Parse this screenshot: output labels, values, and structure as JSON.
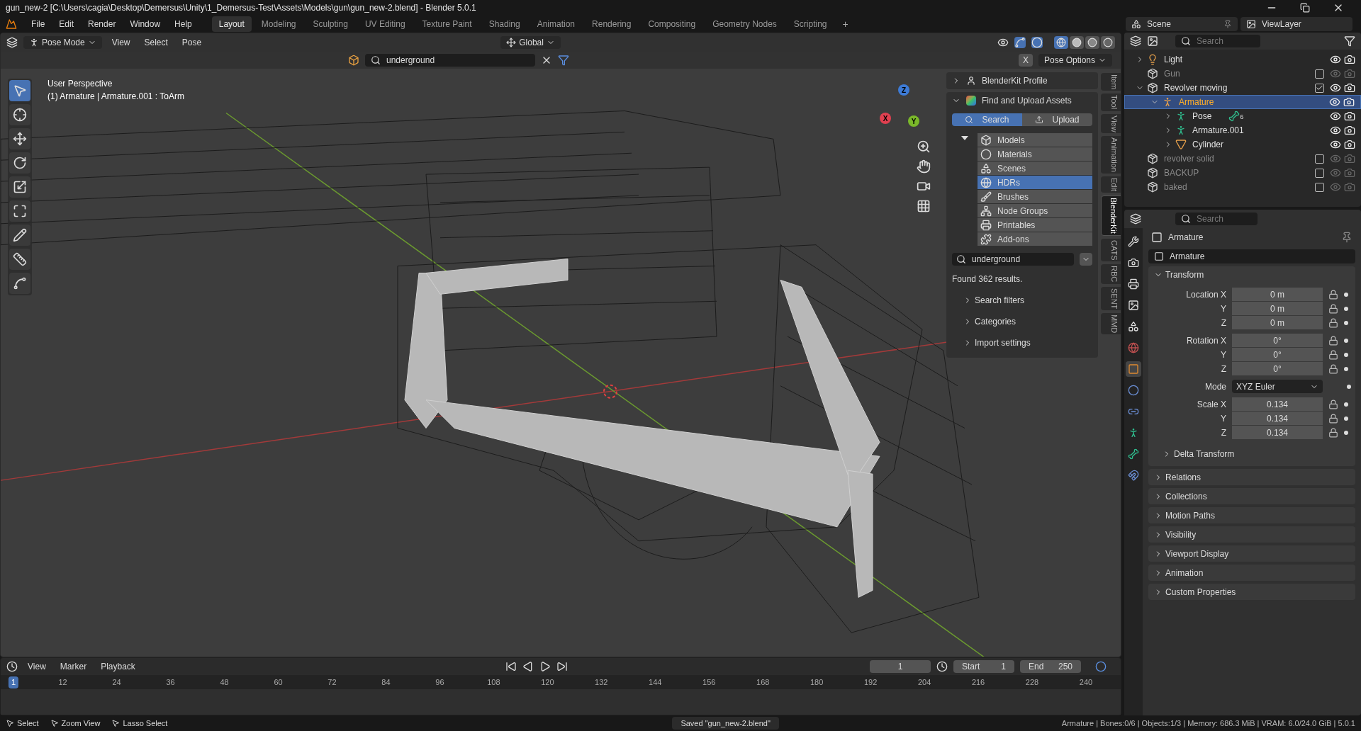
{
  "window": {
    "title": "gun_new-2 [C:\\Users\\cagia\\Desktop\\Demersus\\Unity\\1_Demersus-Test\\Assets\\Models\\gun\\gun_new-2.blend] - Blender 5.0.1"
  },
  "menu": [
    "File",
    "Edit",
    "Render",
    "Window",
    "Help"
  ],
  "workspaces": [
    {
      "label": "Layout",
      "selected": true
    },
    {
      "label": "Modeling",
      "selected": false
    },
    {
      "label": "Sculpting",
      "selected": false
    },
    {
      "label": "UV Editing",
      "selected": false
    },
    {
      "label": "Texture Paint",
      "selected": false
    },
    {
      "label": "Shading",
      "selected": false
    },
    {
      "label": "Animation",
      "selected": false
    },
    {
      "label": "Rendering",
      "selected": false
    },
    {
      "label": "Compositing",
      "selected": false
    },
    {
      "label": "Geometry Nodes",
      "selected": false
    },
    {
      "label": "Scripting",
      "selected": false
    }
  ],
  "add_workspace": "+",
  "viewport": {
    "mode": "Pose Mode",
    "menus": [
      "View",
      "Select",
      "Pose"
    ],
    "orientation": "Global",
    "shading": [
      {
        "kind": "wireframe",
        "selected": true
      },
      {
        "kind": "solid",
        "selected": false
      },
      {
        "kind": "material",
        "selected": false
      },
      {
        "kind": "rendered",
        "selected": false
      }
    ],
    "asset_search": "underground",
    "pose_options": "Pose Options",
    "mirror_x": "X",
    "overlay_lines": [
      "User Perspective",
      "(1) Armature | Armature.001 : ToArm"
    ],
    "gizmo_axes": [
      "X",
      "Y",
      "Z"
    ],
    "tools": [
      {
        "kind": "select",
        "selected": true
      },
      {
        "kind": "cursor",
        "selected": false
      },
      {
        "kind": "move",
        "selected": false
      },
      {
        "kind": "rotate",
        "selected": false
      },
      {
        "kind": "scale",
        "selected": false
      },
      {
        "kind": "transform",
        "selected": false
      },
      {
        "kind": "annotate",
        "selected": false
      },
      {
        "kind": "measure",
        "selected": false
      },
      {
        "kind": "relax",
        "selected": false
      }
    ],
    "side_tabs": [
      {
        "label": "Item",
        "selected": false
      },
      {
        "label": "Tool",
        "selected": false
      },
      {
        "label": "View",
        "selected": false
      },
      {
        "label": "Animation",
        "selected": false
      },
      {
        "label": "Edit",
        "selected": false
      },
      {
        "label": "BlenderKit",
        "selected": true
      },
      {
        "label": "CATS",
        "selected": false
      },
      {
        "label": "RBC",
        "selected": false
      },
      {
        "label": "SENT",
        "selected": false
      },
      {
        "label": "MMD",
        "selected": false
      }
    ]
  },
  "blenderkit": {
    "profile": "BlenderKit Profile",
    "find": "Find and Upload Assets",
    "modes": [
      {
        "label": "Search",
        "selected": true
      },
      {
        "label": "Upload",
        "selected": false
      }
    ],
    "categories_expanded": true,
    "categories": [
      {
        "label": "Models",
        "kind": "models",
        "selected": false
      },
      {
        "label": "Materials",
        "kind": "materials",
        "selected": false
      },
      {
        "label": "Scenes",
        "kind": "scenes",
        "selected": false
      },
      {
        "label": "HDRs",
        "kind": "hdrs",
        "selected": true
      },
      {
        "label": "Brushes",
        "kind": "brushes",
        "selected": false
      },
      {
        "label": "Node Groups",
        "kind": "nodes",
        "selected": false
      },
      {
        "label": "Printables",
        "kind": "printables",
        "selected": false
      },
      {
        "label": "Add-ons",
        "kind": "addons",
        "selected": false
      }
    ],
    "search_value": "underground",
    "results": "Found 362 results.",
    "sections": [
      "Search filters",
      "Categories",
      "Import settings"
    ]
  },
  "outliner": {
    "scene": "Scene",
    "view_layer": "ViewLayer",
    "search_placeholder": "Search",
    "tree": [
      {
        "label": "Light",
        "kind": "light",
        "selected": false,
        "expanded": false
      },
      {
        "label": "Gun",
        "kind": "collection",
        "selected": false,
        "checked": false
      },
      {
        "label": "Revolver moving",
        "kind": "collection",
        "selected": false,
        "checked": true,
        "expanded": true,
        "children": [
          {
            "label": "Armature",
            "kind": "armature",
            "selected": true,
            "expanded": true,
            "children": [
              {
                "label": "Pose",
                "kind": "pose",
                "selected": false,
                "badge": "6",
                "expanded": false
              },
              {
                "label": "Armature.001",
                "kind": "armature_data",
                "selected": false,
                "expanded": false
              },
              {
                "label": "Cylinder",
                "kind": "mesh",
                "selected": false,
                "expanded": false
              }
            ]
          }
        ]
      },
      {
        "label": "revolver solid",
        "kind": "collection",
        "selected": false,
        "checked": false
      },
      {
        "label": "BACKUP",
        "kind": "collection",
        "selected": false,
        "checked": false
      },
      {
        "label": "baked",
        "kind": "collection",
        "selected": false,
        "checked": false
      }
    ]
  },
  "properties": {
    "search_placeholder": "Search",
    "object": "Armature",
    "name": "Armature",
    "tabs": [
      {
        "kind": "tool",
        "selected": false
      },
      {
        "kind": "render",
        "selected": false
      },
      {
        "kind": "output",
        "selected": false
      },
      {
        "kind": "view_layer",
        "selected": false
      },
      {
        "kind": "scene",
        "selected": false
      },
      {
        "kind": "world",
        "selected": false
      },
      {
        "kind": "object",
        "selected": true
      },
      {
        "kind": "physics",
        "selected": false
      },
      {
        "kind": "constraints",
        "selected": false
      },
      {
        "kind": "data",
        "selected": false
      },
      {
        "kind": "bone",
        "selected": false
      },
      {
        "kind": "bone_constraints",
        "selected": false
      }
    ],
    "transform": {
      "title": "Transform",
      "expanded": true,
      "groups": [
        [
          {
            "label": "Location X",
            "value": "0 m"
          },
          {
            "label": "Y",
            "value": "0 m"
          },
          {
            "label": "Z",
            "value": "0 m"
          }
        ],
        [
          {
            "label": "Rotation X",
            "value": "0°"
          },
          {
            "label": "Y",
            "value": "0°"
          },
          {
            "label": "Z",
            "value": "0°"
          }
        ],
        [
          {
            "label": "Mode",
            "value": "XYZ Euler",
            "kind": "dropdown"
          }
        ],
        [
          {
            "label": "Scale X",
            "value": "0.134"
          },
          {
            "label": "Y",
            "value": "0.134"
          },
          {
            "label": "Z",
            "value": "0.134"
          }
        ]
      ],
      "delta": "Delta Transform"
    },
    "panels": [
      "Relations",
      "Collections",
      "Motion Paths",
      "Visibility",
      "Viewport Display",
      "Animation",
      "Custom Properties"
    ]
  },
  "timeline": {
    "menus": [
      "View",
      "Marker",
      "Playback"
    ],
    "current_frame": "1",
    "start_label": "Start",
    "start": "1",
    "end_label": "End",
    "end": "250",
    "ticks": [
      {
        "label": "1",
        "selected": true
      },
      {
        "label": "12",
        "selected": false
      },
      {
        "label": "24",
        "selected": false
      },
      {
        "label": "36",
        "selected": false
      },
      {
        "label": "48",
        "selected": false
      },
      {
        "label": "60",
        "selected": false
      },
      {
        "label": "72",
        "selected": false
      },
      {
        "label": "84",
        "selected": false
      },
      {
        "label": "96",
        "selected": false
      },
      {
        "label": "108",
        "selected": false
      },
      {
        "label": "120",
        "selected": false
      },
      {
        "label": "132",
        "selected": false
      },
      {
        "label": "144",
        "selected": false
      },
      {
        "label": "156",
        "selected": false
      },
      {
        "label": "168",
        "selected": false
      },
      {
        "label": "180",
        "selected": false
      },
      {
        "label": "192",
        "selected": false
      },
      {
        "label": "204",
        "selected": false
      },
      {
        "label": "216",
        "selected": false
      },
      {
        "label": "228",
        "selected": false
      },
      {
        "label": "240",
        "selected": false
      }
    ]
  },
  "status_bar": {
    "hints": [
      "Select",
      "Zoom View",
      "Lasso Select"
    ],
    "message": "Saved \"gun_new-2.blend\"",
    "stats": "Armature | Bones:0/6 | Objects:1/3 | Memory: 686.3 MiB | VRAM: 6.0/24.0 GiB | 5.0.1"
  }
}
